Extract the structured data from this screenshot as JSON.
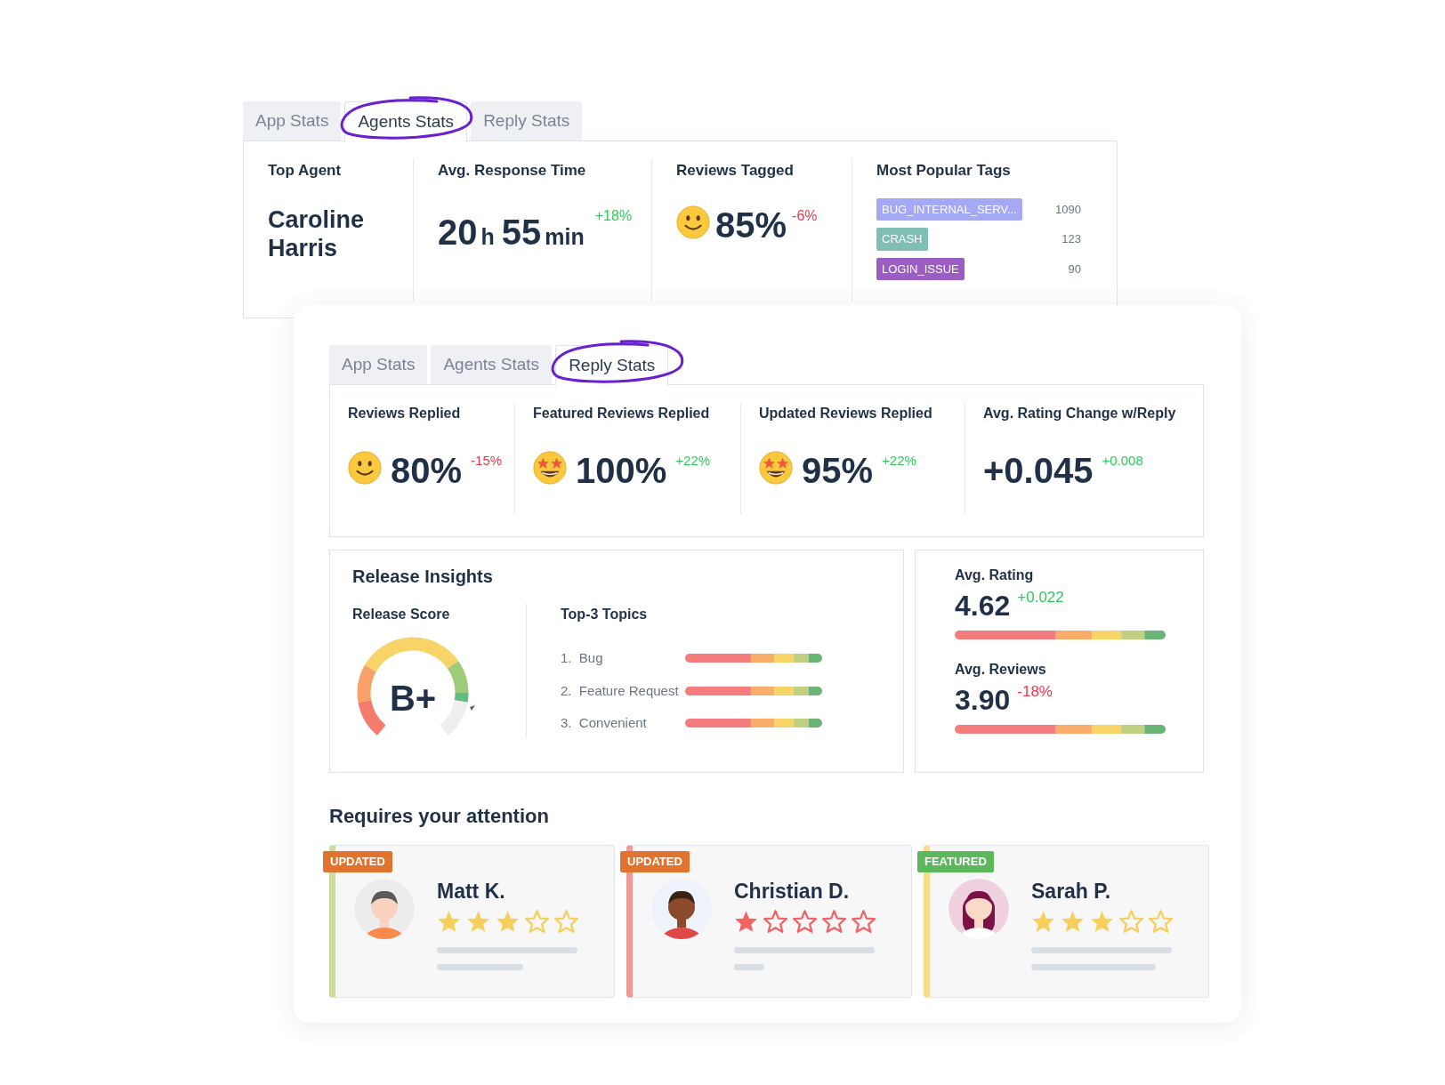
{
  "back_panel": {
    "tabs": [
      {
        "label": "App Stats",
        "selected": false
      },
      {
        "label": "Agents Stats",
        "selected": true
      },
      {
        "label": "Reply Stats",
        "selected": false
      }
    ],
    "top_agent": {
      "label": "Top Agent",
      "name": "Caroline Harris"
    },
    "response_time": {
      "label": "Avg. Response Time",
      "parts": [
        {
          "text": "20",
          "kind": "number"
        },
        {
          "text": "h",
          "kind": "unit"
        },
        {
          "text": "55",
          "kind": "number"
        },
        {
          "text": "min",
          "kind": "unit"
        }
      ],
      "delta": "+18%",
      "color": "#2ecc5a"
    },
    "reviews_tagged": {
      "label": "Reviews Tagged",
      "kind": "smile",
      "value": "85%",
      "delta": "-6%",
      "color": "#f0364a"
    },
    "popular_tags": {
      "label": "Most Popular Tags",
      "tags": [
        {
          "name": "BUG_INTERNAL_SERV...",
          "count": "1090",
          "color": "#a5a8f5"
        },
        {
          "name": "CRASH",
          "count": "123",
          "color": "#7fbfb3"
        },
        {
          "name": "LOGIN_ISSUE",
          "count": "90",
          "color": "#9b5cc4"
        }
      ]
    }
  },
  "front_panel": {
    "tabs": [
      {
        "label": "App Stats",
        "selected": false
      },
      {
        "label": "Agents Stats",
        "selected": false
      },
      {
        "label": "Reply Stats",
        "selected": true
      }
    ],
    "stats": [
      {
        "label": "Reviews Replied",
        "kind": "smile",
        "value": "80%",
        "delta": "-15%",
        "color": "#f0364a"
      },
      {
        "label": "Featured Reviews Replied",
        "kind": "star_eyes",
        "value": "100%",
        "delta": "+22%",
        "color": "#2ecc5a"
      },
      {
        "label": "Updated Reviews Replied",
        "kind": "star_eyes",
        "value": "95%",
        "delta": "+22%",
        "color": "#2ecc5a"
      },
      {
        "label": "Avg. Rating Change w/Reply",
        "kind": "none",
        "value": "+0.045",
        "delta": "+0.008",
        "color": "#2ecc5a"
      }
    ],
    "release_insights": {
      "title": "Release Insights",
      "score_label": "Release Score",
      "score": "B+",
      "topics_label": "Top-3 Topics",
      "topics": [
        {
          "number": "1.",
          "name": "Bug"
        },
        {
          "number": "2.",
          "name": "Feature Request"
        },
        {
          "number": "3.",
          "name": "Convenient"
        }
      ]
    },
    "averages": [
      {
        "label": "Avg. Rating",
        "value": "4.62",
        "delta": "+0.022",
        "color": "#2ecc5a"
      },
      {
        "label": "Avg. Reviews",
        "value": "3.90",
        "delta": "-18%",
        "color": "#f0364a"
      }
    ],
    "attention": {
      "title": "Requires your attention",
      "cards": [
        {
          "badge": "UPDATED",
          "kind": "updated",
          "name": "Matt K.",
          "stars": 3,
          "color": "#cbdc9c"
        },
        {
          "badge": "UPDATED",
          "kind": "updated",
          "name": "Christian D.",
          "stars": 1,
          "color": "#f29a9a"
        },
        {
          "badge": "FEATURED",
          "kind": "featured",
          "name": "Sarah P.",
          "stars": 3,
          "color": "#f7dc8a"
        }
      ]
    }
  }
}
